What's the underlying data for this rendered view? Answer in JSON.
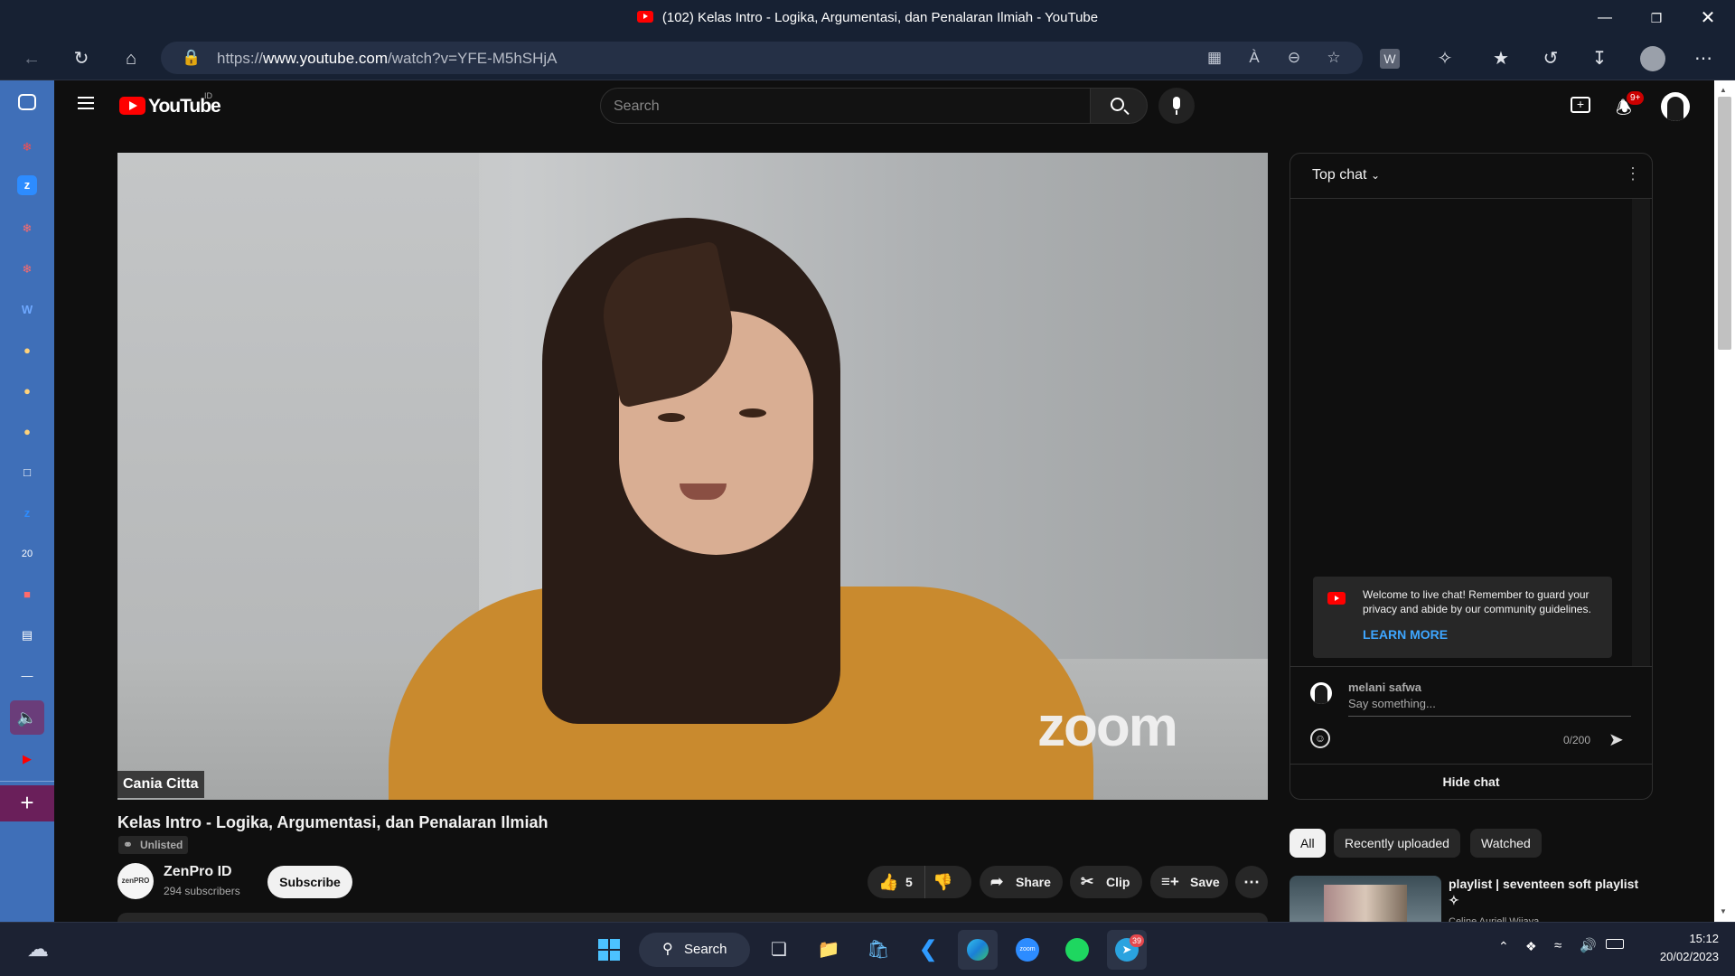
{
  "window": {
    "title": "(102) Kelas Intro - Logika, Argumentasi, dan Penalaran Ilmiah - YouTube"
  },
  "browser": {
    "url_prefix": "https://",
    "url_domain": "www.youtube.com",
    "url_path": "/watch?v=YFE-M5hSHjA"
  },
  "youtube": {
    "logo_text": "YouTube",
    "logo_region": "ID",
    "search_placeholder": "Search",
    "notifications_badge": "9+"
  },
  "video": {
    "speaker_name": "Cania Citta",
    "watermark": "zoom",
    "title": "Kelas Intro - Logika, Argumentasi, dan Penalaran Ilmiah",
    "visibility": "Unlisted"
  },
  "channel": {
    "name": "ZenPro ID",
    "subscribers": "294 subscribers",
    "subscribe_label": "Subscribe"
  },
  "actions": {
    "likes": "5",
    "share": "Share",
    "clip": "Clip",
    "save": "Save"
  },
  "chat": {
    "header": "Top chat",
    "welcome": "Welcome to live chat! Remember to guard your privacy and abide by our community guidelines.",
    "learn_more": "LEARN MORE",
    "user": "melani safwa",
    "input_placeholder": "Say something...",
    "char_count": "0/200",
    "hide_chat": "Hide chat"
  },
  "filters": {
    "chips": [
      "All",
      "Recently uploaded",
      "Watched"
    ],
    "selected": "All"
  },
  "recommendation": {
    "title": "playlist | seventeen soft playlist ✧",
    "channel": "Celine Auriell Wijaya"
  },
  "taskbar": {
    "search_label": "Search",
    "telegram_badge": "39",
    "time": "15:12",
    "date": "20/02/2023"
  },
  "colors": {
    "youtube_red": "#ff0000",
    "edge_sidebar": "#3f6fb8",
    "link_blue": "#3ea6ff",
    "shirt_orange": "#c98a2e"
  }
}
